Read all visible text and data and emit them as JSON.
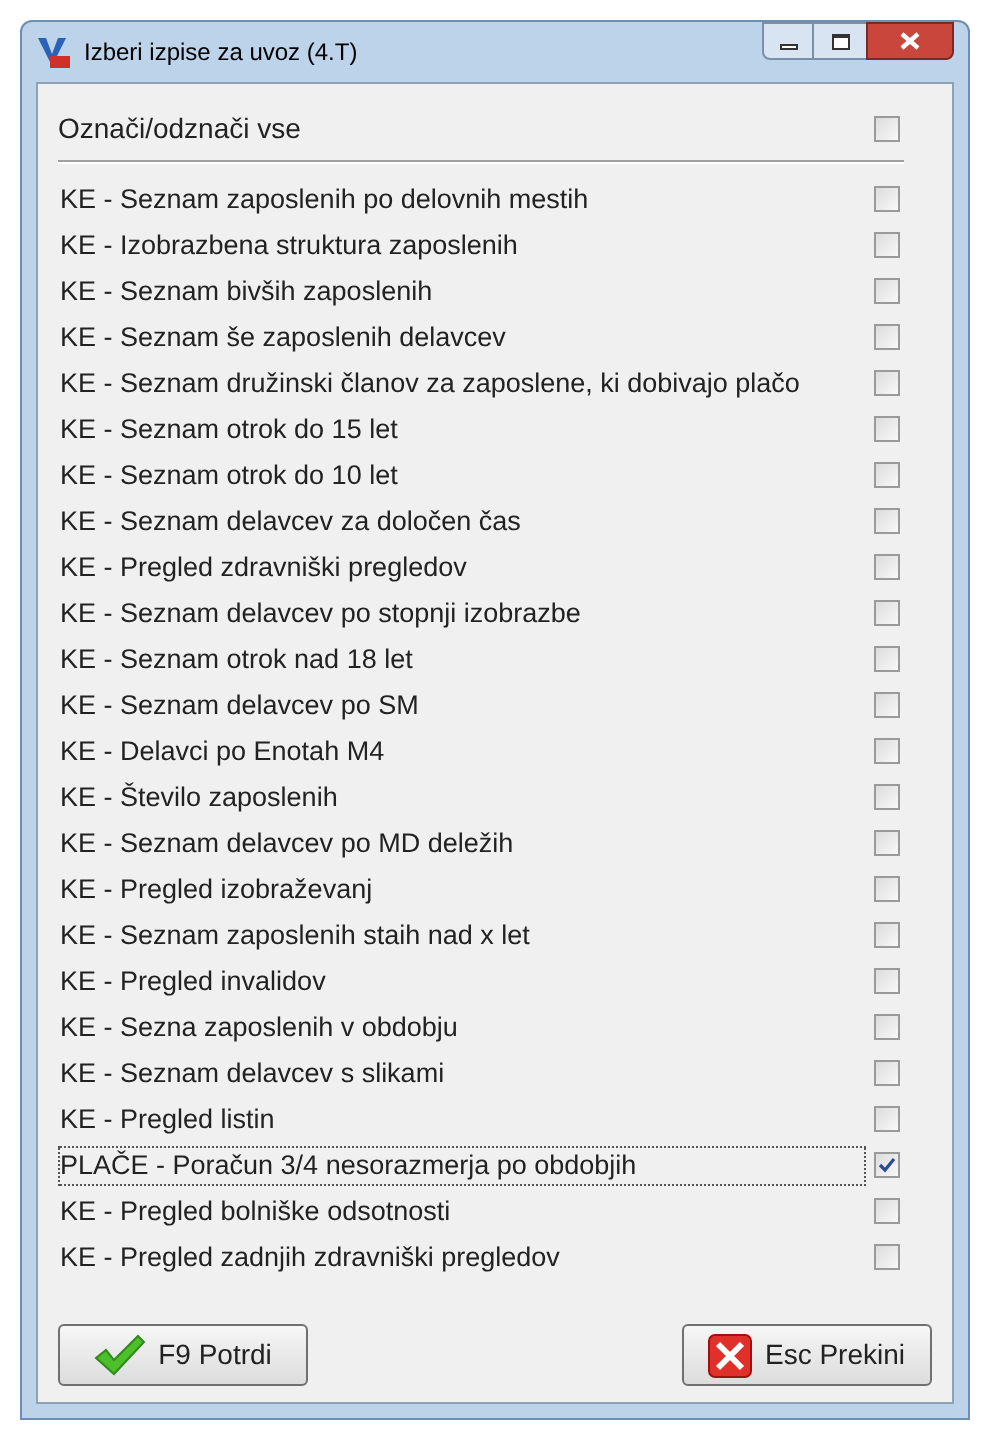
{
  "window": {
    "title": "Izberi izpise za uvoz  (4.T)"
  },
  "select_all": {
    "label": "Označi/odznači vse",
    "checked": false
  },
  "items": [
    {
      "label": "KE - Seznam zaposlenih po delovnih mestih",
      "checked": false,
      "focused": false
    },
    {
      "label": "KE - Izobrazbena struktura zaposlenih",
      "checked": false,
      "focused": false
    },
    {
      "label": "KE - Seznam bivših zaposlenih",
      "checked": false,
      "focused": false
    },
    {
      "label": "KE - Seznam še zaposlenih delavcev",
      "checked": false,
      "focused": false
    },
    {
      "label": "KE - Seznam družinski članov za zaposlene, ki dobivajo plačo",
      "checked": false,
      "focused": false
    },
    {
      "label": "KE - Seznam otrok do 15 let",
      "checked": false,
      "focused": false
    },
    {
      "label": "KE - Seznam otrok do 10 let",
      "checked": false,
      "focused": false
    },
    {
      "label": "KE - Seznam delavcev za določen čas",
      "checked": false,
      "focused": false
    },
    {
      "label": "KE - Pregled zdravniški pregledov",
      "checked": false,
      "focused": false
    },
    {
      "label": "KE - Seznam delavcev po stopnji izobrazbe",
      "checked": false,
      "focused": false
    },
    {
      "label": "KE - Seznam otrok nad 18 let",
      "checked": false,
      "focused": false
    },
    {
      "label": "KE - Seznam delavcev po SM",
      "checked": false,
      "focused": false
    },
    {
      "label": "KE - Delavci po Enotah M4",
      "checked": false,
      "focused": false
    },
    {
      "label": "KE - Število zaposlenih",
      "checked": false,
      "focused": false
    },
    {
      "label": "KE - Seznam delavcev po MD deležih",
      "checked": false,
      "focused": false
    },
    {
      "label": "KE - Pregled izobraževanj",
      "checked": false,
      "focused": false
    },
    {
      "label": "KE - Seznam zaposlenih staih nad x let",
      "checked": false,
      "focused": false
    },
    {
      "label": "KE - Pregled invalidov",
      "checked": false,
      "focused": false
    },
    {
      "label": "KE - Sezna zaposlenih v obdobju",
      "checked": false,
      "focused": false
    },
    {
      "label": "KE - Seznam delavcev s slikami",
      "checked": false,
      "focused": false
    },
    {
      "label": "KE - Pregled listin",
      "checked": false,
      "focused": false
    },
    {
      "label": "PLAČE - Poračun 3/4 nesorazmerja po obdobjih",
      "checked": true,
      "focused": true
    },
    {
      "label": "KE - Pregled bolniške odsotnosti",
      "checked": false,
      "focused": false
    },
    {
      "label": "KE - Pregled zadnjih zdravniški pregledov",
      "checked": false,
      "focused": false
    }
  ],
  "buttons": [
    {
      "label": "F9 Potrdi",
      "kind": "confirm"
    },
    {
      "label": "Esc Prekini",
      "kind": "cancel"
    }
  ]
}
